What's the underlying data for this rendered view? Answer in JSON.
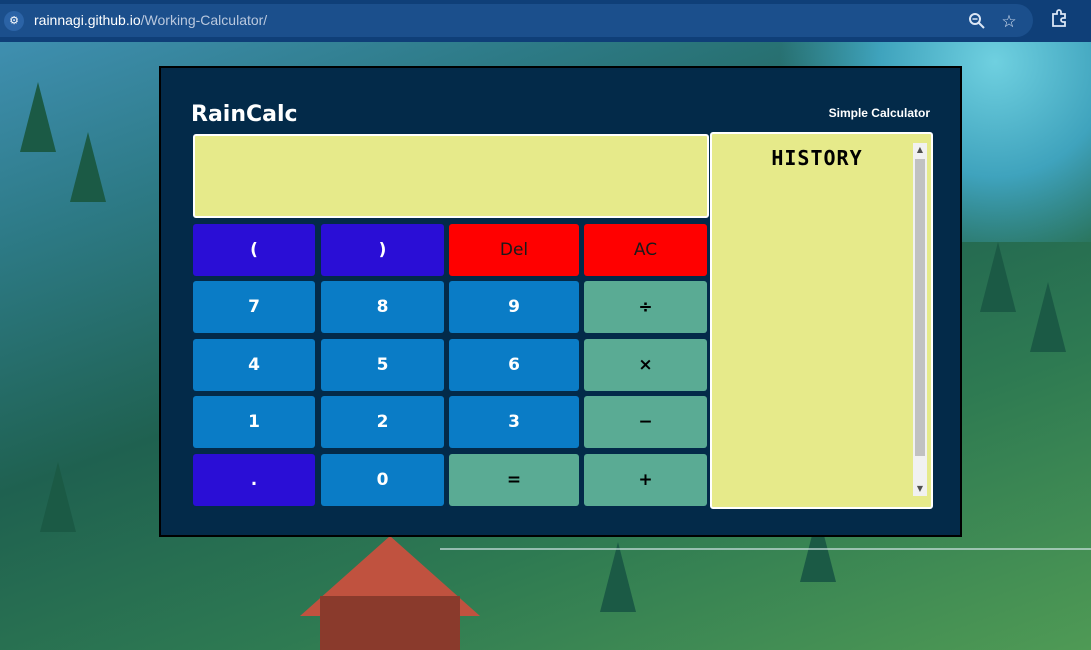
{
  "browser": {
    "url_host": "rainnagi.github.io",
    "url_path": "/Working-Calculator/",
    "icons": [
      "site-settings-icon",
      "zoom-icon",
      "bookmark-star-icon",
      "extensions-icon"
    ]
  },
  "calculator": {
    "brand": "RainCalc",
    "subtitle": "Simple Calculator",
    "display_value": "",
    "history_title": "HISTORY",
    "buttons": {
      "open_paren": "(",
      "close_paren": ")",
      "del": "Del",
      "ac": "AC",
      "seven": "7",
      "eight": "8",
      "nine": "9",
      "divide": "÷",
      "four": "4",
      "five": "5",
      "six": "6",
      "multiply": "×",
      "one": "1",
      "two": "2",
      "three": "3",
      "minus": "−",
      "dot": ".",
      "zero": "0",
      "equals": "=",
      "plus": "+"
    }
  },
  "colors": {
    "panel": "#032a49",
    "display": "#e6ea8a",
    "paren_button": "#2a0ed6",
    "number_button": "#0a7cc6",
    "clear_button": "#ff0000",
    "operator_button": "#5aab94"
  }
}
